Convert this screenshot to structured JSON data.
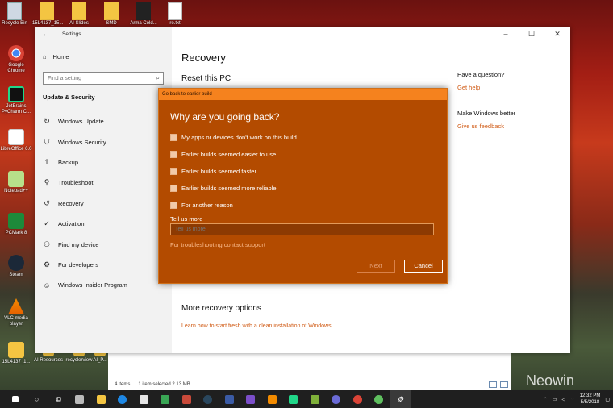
{
  "desktop": {
    "top_icons": [
      "Recycle Bin",
      "15L4137_15...",
      "AI Slides",
      "SMD",
      "Arma Cold...",
      "ro.txt"
    ],
    "left_icons": [
      "Google Chrome",
      "JetBrains PyCharm C...",
      "LibreOffice 6.0",
      "Notepad++",
      "PCMark 8",
      "Steam",
      "VLC media player",
      "15L4137_1..."
    ],
    "bottom_icons": [
      "AI Resources",
      "recyclerview",
      "AI_P..."
    ],
    "watermark": "Neowin"
  },
  "explorer": {
    "items_count": "4 items",
    "selected": "1 item selected  2.13 MB"
  },
  "settings": {
    "window_title": "Settings",
    "home": "Home",
    "search_placeholder": "Find a setting",
    "section": "Update & Security",
    "nav": [
      {
        "label": "Windows Update",
        "icon": "refresh-icon"
      },
      {
        "label": "Windows Security",
        "icon": "shield-icon"
      },
      {
        "label": "Backup",
        "icon": "backup-icon"
      },
      {
        "label": "Troubleshoot",
        "icon": "wrench-icon"
      },
      {
        "label": "Recovery",
        "icon": "recovery-icon"
      },
      {
        "label": "Activation",
        "icon": "check-circle-icon"
      },
      {
        "label": "Find my device",
        "icon": "person-pin-icon"
      },
      {
        "label": "For developers",
        "icon": "developer-icon"
      },
      {
        "label": "Windows Insider Program",
        "icon": "insider-icon"
      }
    ],
    "page_title": "Recovery",
    "reset_title": "Reset this PC",
    "more_title": "More recovery options",
    "more_link": "Learn how to start fresh with a clean installation of Windows",
    "side": {
      "question": "Have a question?",
      "help": "Get help",
      "better": "Make Windows better",
      "feedback": "Give us feedback"
    }
  },
  "dialog": {
    "title": "Go back to earlier build",
    "question": "Why are you going back?",
    "options": [
      "My apps or devices don't work on this build",
      "Earlier builds seemed easier to use",
      "Earlier builds seemed faster",
      "Earlier builds seemed more reliable",
      "For another reason"
    ],
    "tell_label": "Tell us more",
    "tell_placeholder": "Tell us more",
    "support_link": "For troubleshooting contact support",
    "next": "Next",
    "cancel": "Cancel"
  },
  "taskbar": {
    "time": "12:32 PM",
    "date": "5/5/2018"
  }
}
